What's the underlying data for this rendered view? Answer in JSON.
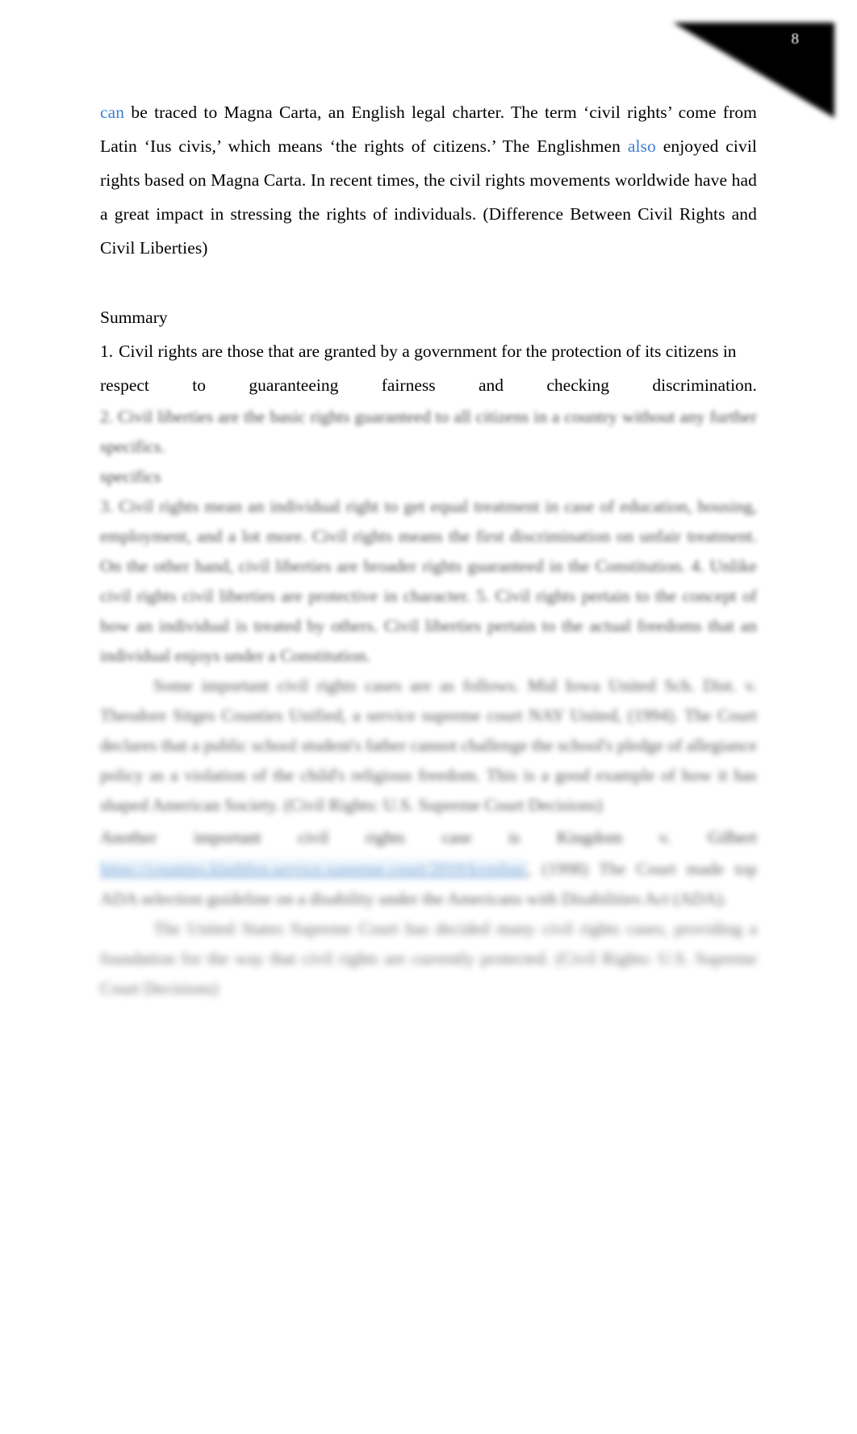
{
  "document": {
    "page_number": "8",
    "corner_marker": "black-triangle-page-flag",
    "accent_link_color": "#3d7fd1",
    "paragraphs": {
      "intro": {
        "line1_prefix_link": "can",
        "line1_rest": " be traced to Magna Carta, an English legal charter. The term ‘civil rights’ come from Latin",
        "line2_before": "‘Ius civis,’ which means ‘the rights of citizens.’ The Englishmen ",
        "line2_link": "also",
        "line2_after": " enjoyed civil rights based",
        "line3": "on Magna Carta. In recent times, the civil rights movements worldwide have had a great impact",
        "line4": "in stressing the rights of individuals.  (Difference Between Civil Rights and Civil Liberties)"
      }
    },
    "summary": {
      "heading": "Summary",
      "items": [
        {
          "marker": "1.",
          "line1": "Civil rights are those that are granted by a government for the protection of its citizens in",
          "line2_words": [
            "respect",
            "to",
            "guaranteeing",
            "fairness",
            "and",
            "checking",
            "discrimination."
          ]
        }
      ]
    },
    "obscured_content": {
      "note": "remaining body text is rendered blurred / unreadable in the screenshot",
      "blocks": [
        {
          "id": "blur-item-2",
          "lines": [
            "2. Civil liberties are the basic rights guaranteed to all citizens in a country without any further specifics.",
            "specifics"
          ]
        },
        {
          "id": "blur-item-3",
          "lines": [
            "3. Civil rights mean an individual right to get equal treatment in case of education, housing,",
            "employment, and a lot more.  Civil rights means the first discrimination on unfair treatment.",
            "On the other hand,  civil liberties  are broader rights guaranteed in the Constitution.",
            "4. Unlike civil rights civil liberties are protective in character.",
            "5. Civil rights pertain to the concept of how an individual is treated by others. Civil liberties",
            "pertain to the actual freedoms that an individual enjoys under a Constitution."
          ]
        },
        {
          "id": "blur-paragraph-1",
          "lines": [
            "Some important civil rights cases are as follows.  Mid Iowa United Sch. Dist. v. Theodore",
            "Sitges Counties Unified, a service supreme court NAY United, (1994). The Court declares that a",
            "public school student's father cannot challenge the school's pledge of allegiance policy as a",
            "violation of the child's religious freedom.  This is a good example of how it has shaped American",
            "Society. (Civil Rights:  U.S. Supreme Court Decisions)"
          ]
        },
        {
          "id": "blur-paragraph-2-with-link",
          "lead_words": [
            "Another",
            "important",
            "civil",
            "rights",
            "case",
            "is",
            "Kingdom",
            "v.",
            "Gilbert"
          ],
          "link_text": "https://counties.kluthfen.service.supreme.court/2010/kvmlpn/",
          "tail": ", (1998) The Court made top ADA selection guideline on a disability under the Americans with Disabilities Act (ADA)."
        },
        {
          "id": "blur-paragraph-3",
          "lines": [
            "The United States Supreme Court has decided many civil rights cases, providing a",
            "foundation for the way that civil rights are currently protected. (Civil Rights:  U.S. Supreme",
            "Court Decisions)"
          ]
        }
      ]
    }
  }
}
